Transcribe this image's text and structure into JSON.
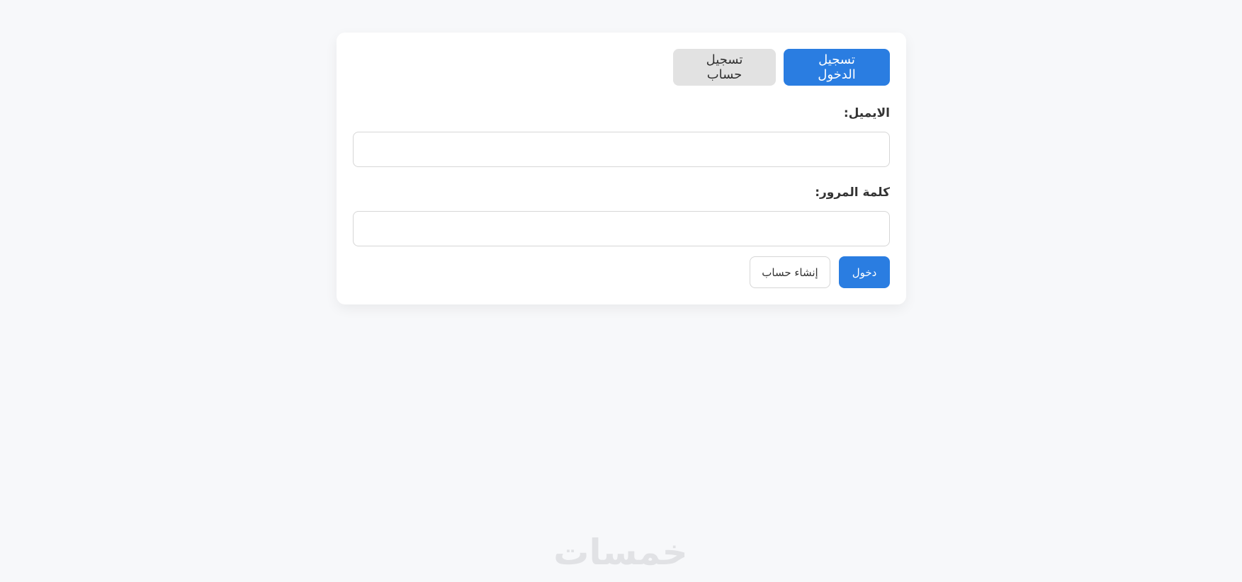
{
  "tabs": {
    "login_label": "تسجيل الدخول",
    "register_label": "تسجيل حساب"
  },
  "form": {
    "email_label": "الايميل:",
    "email_value": "",
    "password_label": "كلمة المرور:",
    "password_value": "",
    "submit_label": "دخول",
    "create_account_label": "إنشاء حساب"
  },
  "watermark": {
    "text": "خمسات"
  },
  "colors": {
    "accent": "#2a7de1",
    "background": "#f7f8fa",
    "card": "#ffffff",
    "inactive_tab": "#e2e2e2",
    "border": "#d6d6d6"
  }
}
